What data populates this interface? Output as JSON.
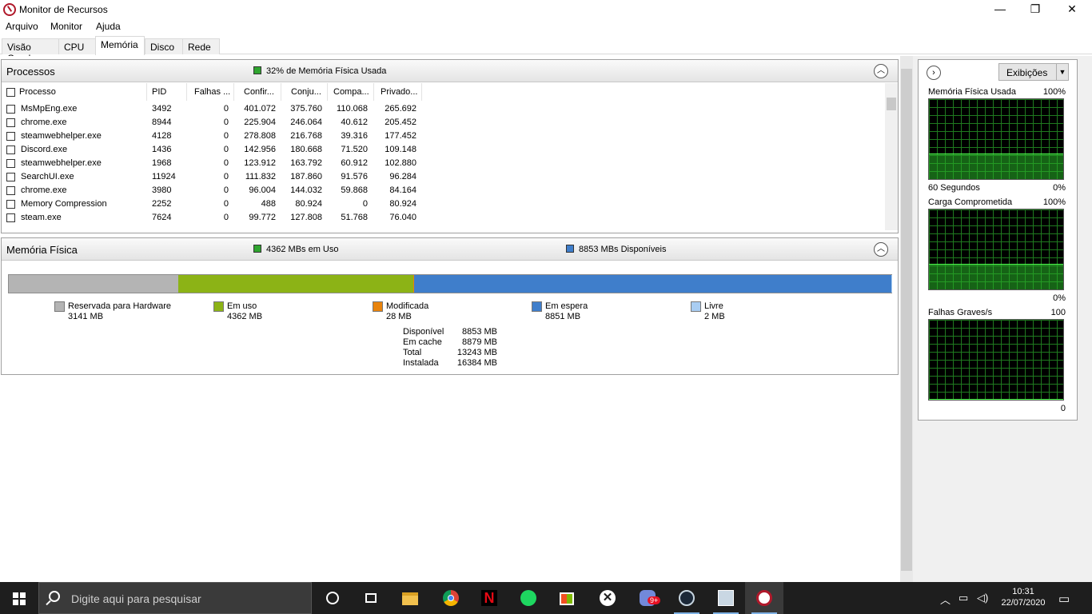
{
  "window": {
    "title": "Monitor de Recursos",
    "minimize": "—",
    "maximize": "❐",
    "close": "✕"
  },
  "menu": [
    "Arquivo",
    "Monitor",
    "Ajuda"
  ],
  "tabs": [
    "Visão Geral",
    "CPU",
    "Memória",
    "Disco",
    "Rede"
  ],
  "active_tab": "Memória",
  "processes": {
    "title": "Processos",
    "info": "32% de Memória Física Usada",
    "columns": [
      "Processo",
      "PID",
      "Falhas ...",
      "Confir...",
      "Conju...",
      "Compa...",
      "Privado..."
    ],
    "rows": [
      [
        "MsMpEng.exe",
        "3492",
        "0",
        "401.072",
        "375.760",
        "110.068",
        "265.692"
      ],
      [
        "chrome.exe",
        "8944",
        "0",
        "225.904",
        "246.064",
        "40.612",
        "205.452"
      ],
      [
        "steamwebhelper.exe",
        "4128",
        "0",
        "278.808",
        "216.768",
        "39.316",
        "177.452"
      ],
      [
        "Discord.exe",
        "1436",
        "0",
        "142.956",
        "180.668",
        "71.520",
        "109.148"
      ],
      [
        "steamwebhelper.exe",
        "1968",
        "0",
        "123.912",
        "163.792",
        "60.912",
        "102.880"
      ],
      [
        "SearchUI.exe",
        "11924",
        "0",
        "111.832",
        "187.860",
        "91.576",
        "96.284"
      ],
      [
        "chrome.exe",
        "3980",
        "0",
        "96.004",
        "144.032",
        "59.868",
        "84.164"
      ],
      [
        "Memory Compression",
        "2252",
        "0",
        "488",
        "80.924",
        "0",
        "80.924"
      ],
      [
        "steam.exe",
        "7624",
        "0",
        "99.772",
        "127.808",
        "51.768",
        "76.040"
      ]
    ]
  },
  "physical": {
    "title": "Memória Física",
    "in_use": "4362 MBs em Uso",
    "available": "8853 MBs Disponíveis",
    "bar_mb": {
      "reserved": 3141,
      "in_use": 4362,
      "modified": 28,
      "standby": 8851,
      "free": 2
    },
    "legend": [
      {
        "label": "Reservada para Hardware",
        "value": "3141 MB",
        "color": "#b4b4b4"
      },
      {
        "label": "Em uso",
        "value": "4362 MB",
        "color": "#8cb316"
      },
      {
        "label": "Modificada",
        "value": "28 MB",
        "color": "#e8830c"
      },
      {
        "label": "Em espera",
        "value": "8851 MB",
        "color": "#3f7ecb"
      },
      {
        "label": "Livre",
        "value": "2 MB",
        "color": "#a9cdf2"
      }
    ],
    "stats": [
      {
        "label": "Disponível",
        "value": "8853 MB"
      },
      {
        "label": "Em cache",
        "value": "8879 MB"
      },
      {
        "label": "Total",
        "value": "13243 MB"
      },
      {
        "label": "Instalada",
        "value": "16384 MB"
      }
    ]
  },
  "views": {
    "button": "Exibições",
    "graphs": [
      {
        "title": "Memória Física Usada",
        "max": "100%",
        "foot_left": "60 Segundos",
        "foot_right": "0%",
        "level": 0.32
      },
      {
        "title": "Carga Comprometida",
        "max": "100%",
        "foot_left": "",
        "foot_right": "0%",
        "level": 0.32
      },
      {
        "title": "Falhas Graves/s",
        "max": "100",
        "foot_left": "",
        "foot_right": "0",
        "level": 0.0
      }
    ]
  },
  "taskbar": {
    "search_placeholder": "Digite aqui para pesquisar",
    "time": "10:31",
    "date": "22/07/2020",
    "badge": "9+"
  },
  "colors": {
    "accent": "#0078d7",
    "graph_green": "#4fff4f"
  }
}
